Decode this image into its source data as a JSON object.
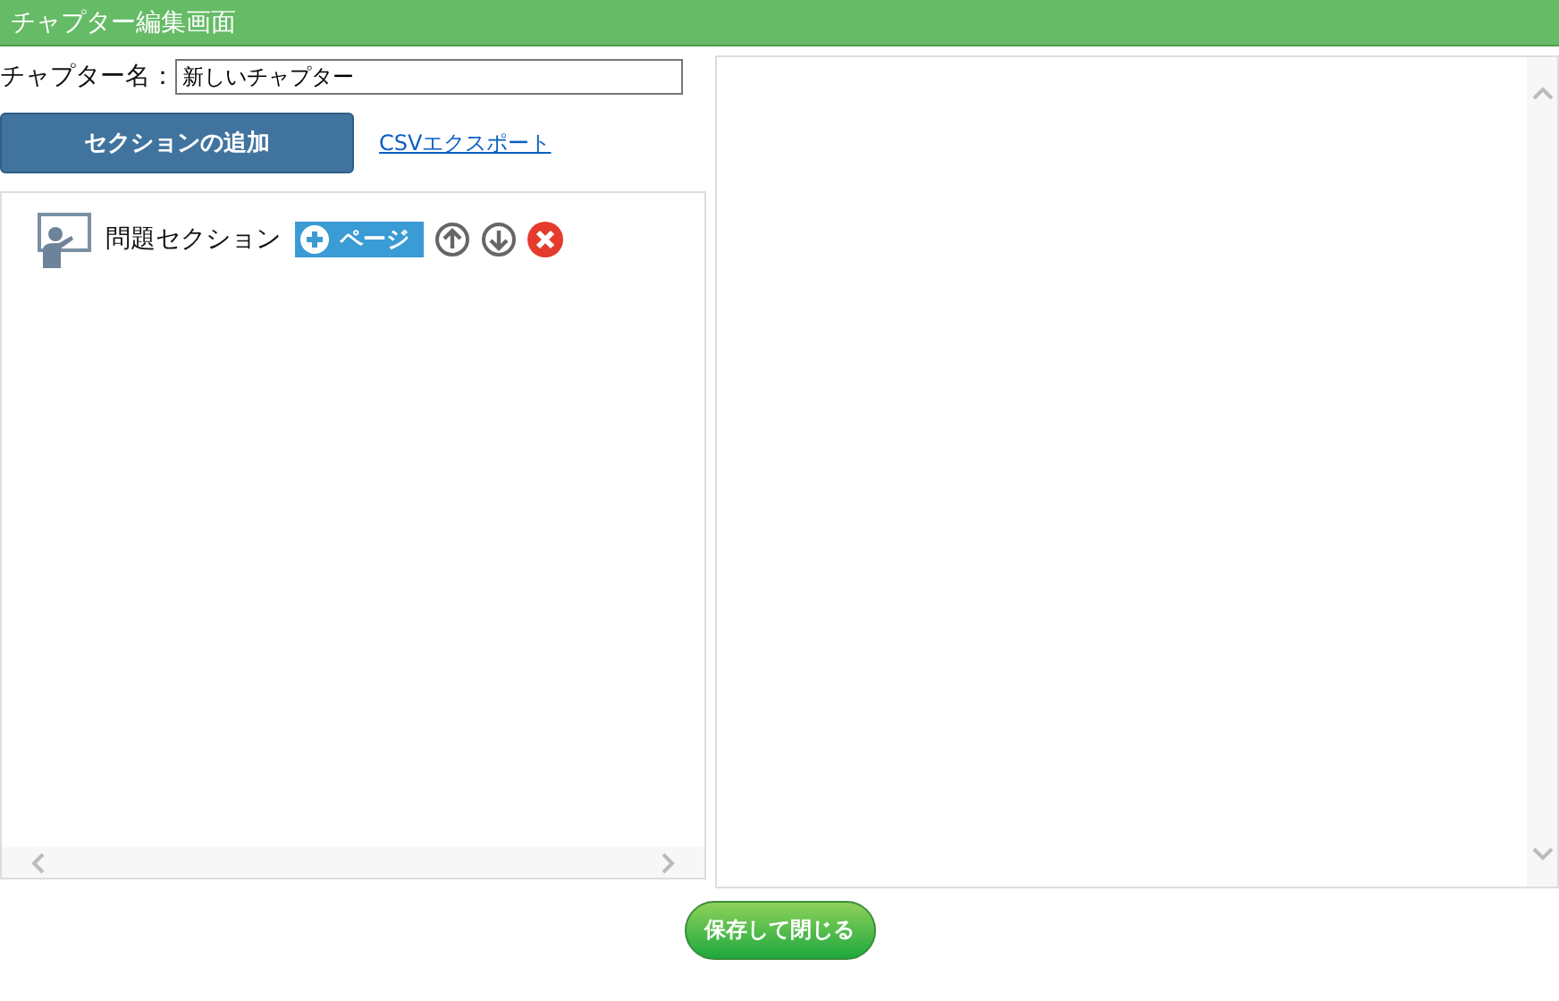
{
  "window": {
    "title": "チャプター編集画面"
  },
  "chapter_name": {
    "label": "チャプター名：",
    "value": "新しいチャプター"
  },
  "add_section_button": "セクションの追加",
  "csv_export_link": "CSVエクスポート",
  "sections": [
    {
      "title": "問題セクション",
      "add_page_button": "ページ"
    }
  ],
  "save_button": "保存して閉じる"
}
